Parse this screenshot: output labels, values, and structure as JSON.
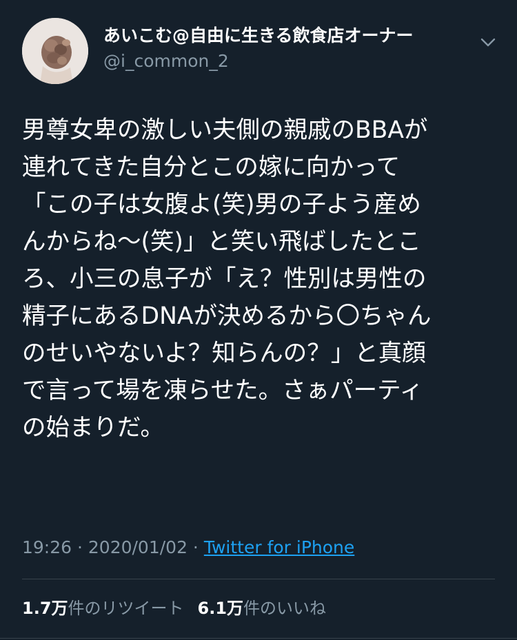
{
  "user": {
    "display_name": "あいこむ@自由に生きる飲食店オーナー",
    "handle": "@i_common_2",
    "avatar_icon": "user-avatar-photo"
  },
  "tweet": {
    "lines": [
      "男尊女卑の激しい夫側の親戚のBBAが",
      "連れてきた自分とこの嫁に向かって",
      "「この子は女腹よ(笑)男の子よう産め",
      "んからね〜(笑)」と笑い飛ばしたとこ",
      "ろ、小三の息子が「え？性別は男性の",
      "精子にあるDNAが決めるから〇ちゃん",
      "のせいやないよ？知らんの？」と真顔",
      "で言って場を凍らせた。さぁパーティ",
      "の始まりだ。"
    ]
  },
  "meta": {
    "time": "19:26",
    "separator": " · ",
    "date": "2020/01/02",
    "source": "Twitter for iPhone"
  },
  "stats": {
    "retweets_count": "1.7万",
    "retweets_label": "件のリツイート",
    "likes_count": "6.1万",
    "likes_label": "件のいいね"
  },
  "colors": {
    "background": "#15202b",
    "secondary_text": "#8899a6",
    "link": "#1da1f2",
    "divider": "#38444d"
  }
}
